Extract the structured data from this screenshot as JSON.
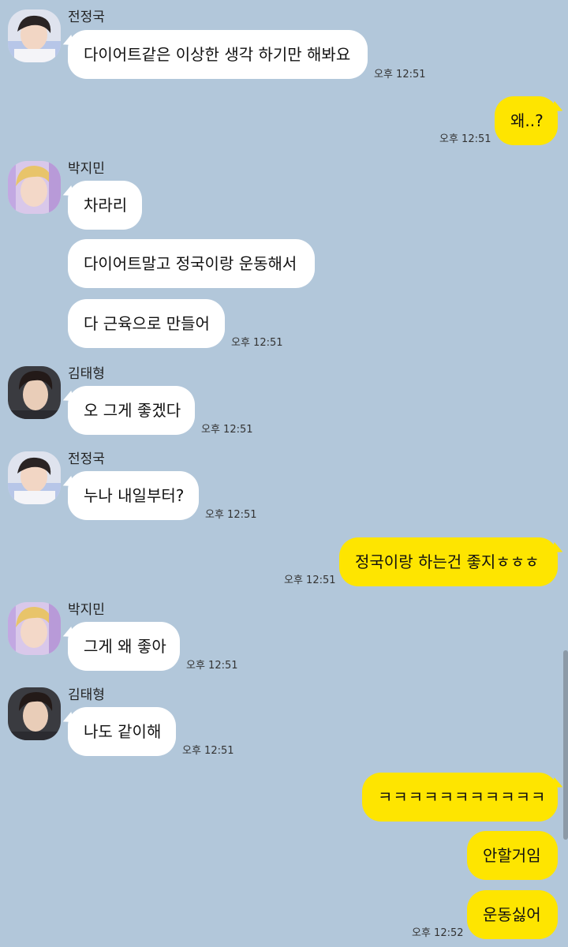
{
  "participants": {
    "jungkook": {
      "name": "전정국",
      "avatar_icon": "profile-photo-jungkook"
    },
    "jimin": {
      "name": "박지민",
      "avatar_icon": "profile-photo-jimin"
    },
    "taehyung": {
      "name": "김태형",
      "avatar_icon": "profile-photo-taehyung"
    }
  },
  "colors": {
    "background": "#b2c7da",
    "incoming_bubble": "#ffffff",
    "outgoing_bubble": "#fee500"
  },
  "messages": [
    {
      "sender": "전정국",
      "text": "다이어트같은 이상한 생각 하기만 해봐요",
      "time": "오후 12:51"
    },
    {
      "sender": "me",
      "text": "왜..?",
      "time": "오후 12:51"
    },
    {
      "sender": "박지민",
      "text": "차라리",
      "time": ""
    },
    {
      "sender": "박지민",
      "text": "다이어트말고 정국이랑 운동해서",
      "time": ""
    },
    {
      "sender": "박지민",
      "text": "다 근육으로 만들어",
      "time": "오후 12:51"
    },
    {
      "sender": "김태형",
      "text": "오 그게 좋겠다",
      "time": "오후 12:51"
    },
    {
      "sender": "전정국",
      "text": "누나 내일부터?",
      "time": "오후 12:51"
    },
    {
      "sender": "me",
      "text": "정국이랑 하는건 좋지ㅎㅎㅎ",
      "time": "오후 12:51"
    },
    {
      "sender": "박지민",
      "text": "그게 왜 좋아",
      "time": "오후 12:51"
    },
    {
      "sender": "김태형",
      "text": "나도 같이해",
      "time": "오후 12:51"
    },
    {
      "sender": "me",
      "text": "ㅋㅋㅋㅋㅋㅋㅋㅋㅋㅋㅋ",
      "time": ""
    },
    {
      "sender": "me",
      "text": "안할거임",
      "time": ""
    },
    {
      "sender": "me",
      "text": "운동싫어",
      "time": "오후 12:52"
    }
  ]
}
